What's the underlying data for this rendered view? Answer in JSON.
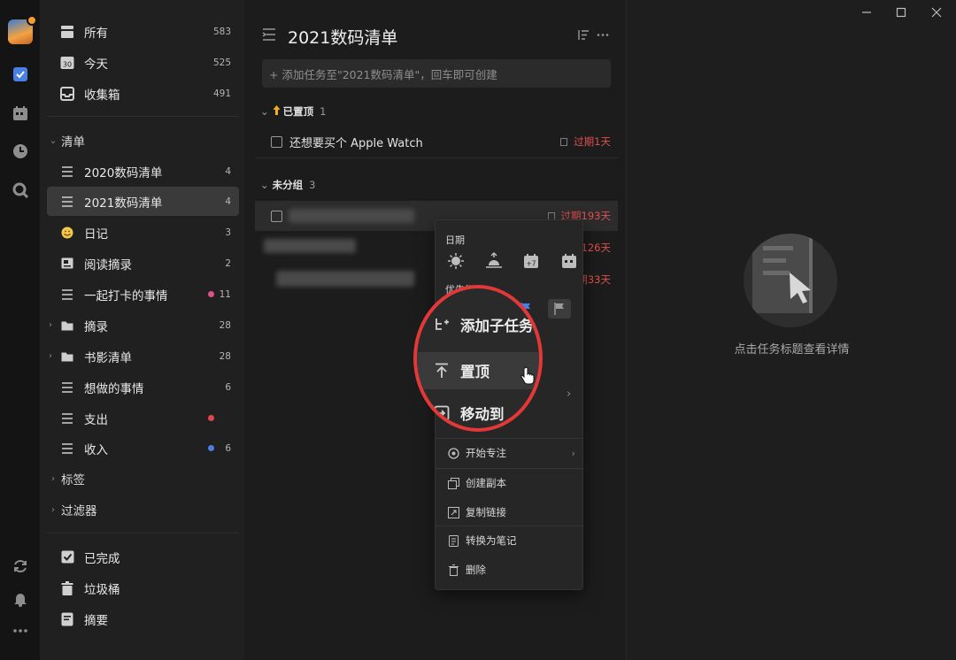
{
  "sidebar": {
    "smart_lists": [
      {
        "label": "所有",
        "count": "583"
      },
      {
        "label": "今天",
        "count": "525"
      },
      {
        "label": "收集箱",
        "count": "491"
      }
    ],
    "lists_section": "清单",
    "lists": [
      {
        "label": "2020数码清单",
        "count": "4"
      },
      {
        "label": "2021数码清单",
        "count": "4"
      },
      {
        "label": "日记",
        "count": "3"
      },
      {
        "label": "阅读摘录",
        "count": "2"
      },
      {
        "label": "一起打卡的事情",
        "count": "11",
        "dot": "#e0508a"
      },
      {
        "label": "摘录",
        "count": "28"
      },
      {
        "label": "书影清单",
        "count": "28"
      },
      {
        "label": "想做的事情",
        "count": "6"
      },
      {
        "label": "支出",
        "count": "",
        "dot": "#e04848"
      },
      {
        "label": "收入",
        "count": "6",
        "dot": "#4d7ee8"
      }
    ],
    "tags_section": "标签",
    "filters_section": "过滤器",
    "bottom": [
      {
        "label": "已完成"
      },
      {
        "label": "垃圾桶"
      },
      {
        "label": "摘要"
      }
    ],
    "today_icon_day": "30"
  },
  "main": {
    "title": "2021数码清单",
    "add_placeholder": "+ 添加任务至\"2021数码清单\"，回车即可创建",
    "pinned_group": {
      "label": "已置顶",
      "count": "1"
    },
    "pinned_task": {
      "text": "还想要买个 Apple Watch",
      "due": "过期1天"
    },
    "ungrouped_group": {
      "label": "未分组",
      "count": "3"
    },
    "tasks_due": [
      "过期193天",
      "期126天",
      "期33天"
    ]
  },
  "context_menu": {
    "date_label": "日期",
    "date_plus": "+7",
    "priority_label": "优先级",
    "items": [
      {
        "label": "开始专注"
      },
      {
        "label": "创建副本"
      },
      {
        "label": "复制链接"
      },
      {
        "label": "转换为笔记"
      },
      {
        "label": "删除"
      }
    ]
  },
  "magnifier": {
    "items": [
      {
        "label": "添加子任务"
      },
      {
        "label": "置顶"
      },
      {
        "label": "移动到"
      }
    ]
  },
  "detail": {
    "empty_text": "点击任务标题查看详情"
  },
  "colors": {
    "overdue": "#e05050",
    "highlight_ring": "#e23838",
    "accent_blue": "#4a7fe5"
  }
}
